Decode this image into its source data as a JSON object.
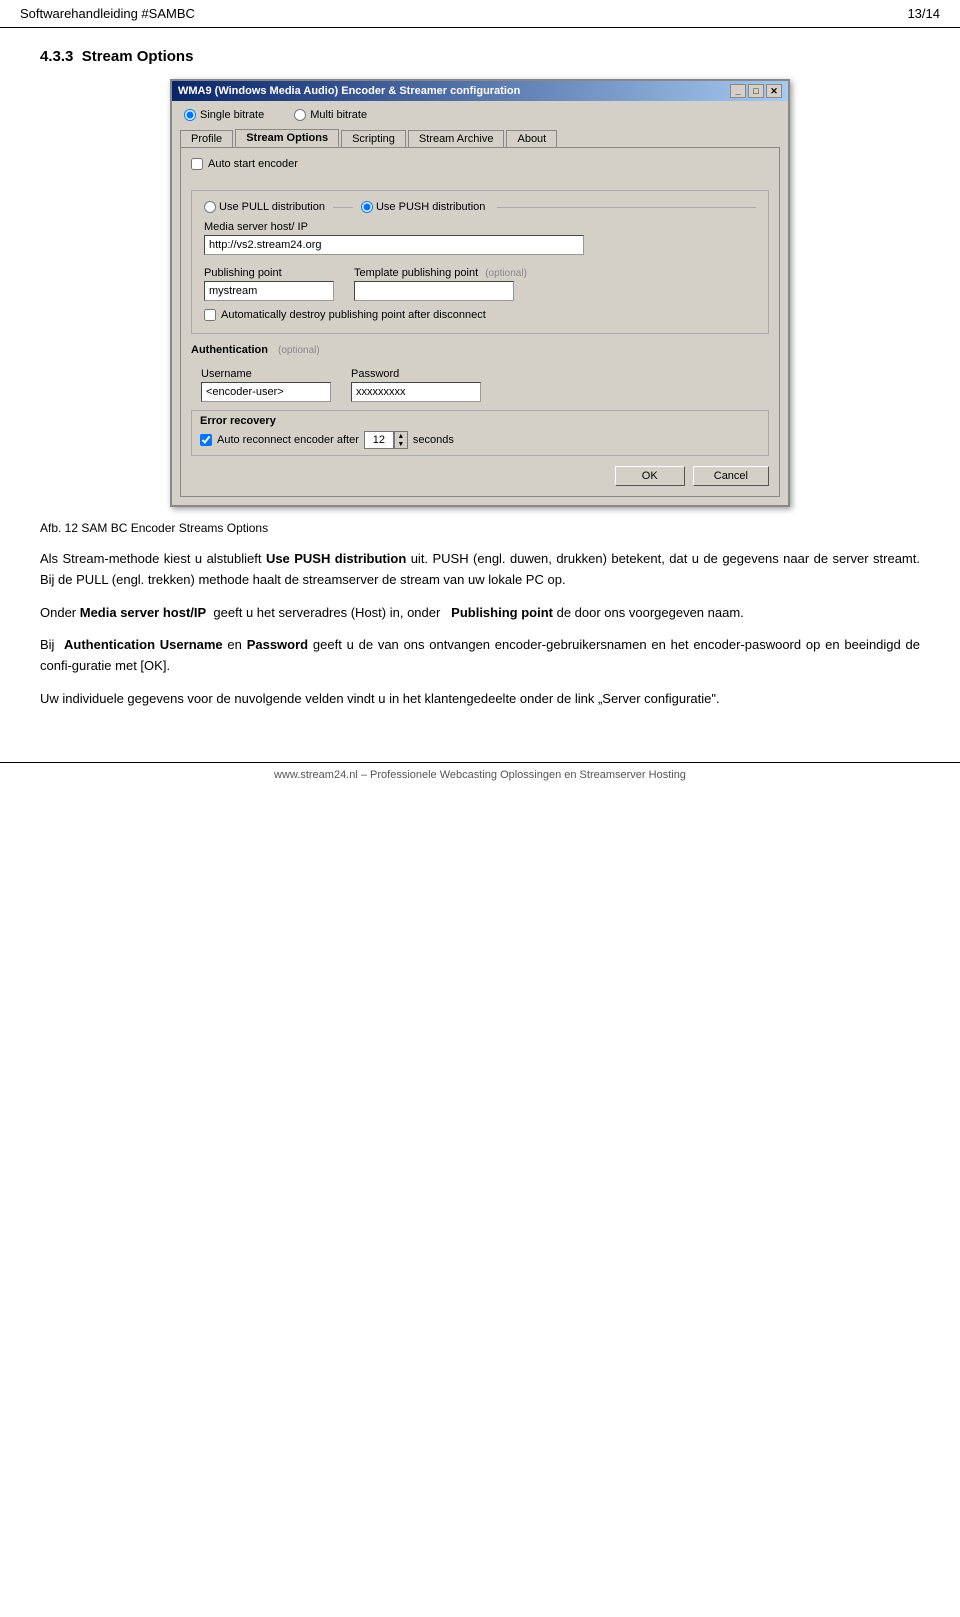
{
  "header": {
    "title": "Softwarehandleiding #SAMBC",
    "page": "13/14"
  },
  "section": {
    "number": "4.3.3",
    "title": "Stream Options"
  },
  "dialog": {
    "title": "WMA9 (Windows Media Audio) Encoder & Streamer configuration",
    "titlebar_buttons": [
      "_",
      "□",
      "✕"
    ],
    "radio_options": [
      {
        "label": "Single bitrate",
        "checked": true
      },
      {
        "label": "Multi bitrate",
        "checked": false
      }
    ],
    "tabs": [
      {
        "label": "Profile",
        "active": false
      },
      {
        "label": "Stream Options",
        "active": true
      },
      {
        "label": "Scripting",
        "active": false
      },
      {
        "label": "Stream Archive",
        "active": false
      },
      {
        "label": "About",
        "active": false
      }
    ],
    "tab_content": {
      "auto_start": {
        "checkbox_label": "Auto start encoder",
        "checked": false
      },
      "distribution": {
        "pull_label": "Use PULL distribution",
        "pull_checked": false,
        "push_label": "Use PUSH distribution",
        "push_checked": true,
        "media_server_label": "Media server host/ IP",
        "media_server_value": "http://vs2.stream24.org",
        "publishing_point_label": "Publishing point",
        "publishing_point_value": "mystream",
        "template_label": "Template publishing point",
        "template_optional": "(optional)",
        "template_value": "",
        "auto_destroy_label": "Automatically destroy publishing point after disconnect",
        "auto_destroy_checked": false
      },
      "authentication": {
        "title": "Authentication",
        "optional": "(optional)",
        "username_label": "Username",
        "username_value": "<encoder-user>",
        "password_label": "Password",
        "password_value": "xxxxxxxxx"
      },
      "error_recovery": {
        "title": "Error recovery",
        "checkbox_label": "Auto reconnect encoder after",
        "checkbox_checked": true,
        "seconds_value": "12",
        "seconds_label": "seconds"
      },
      "buttons": {
        "ok": "OK",
        "cancel": "Cancel"
      }
    }
  },
  "caption": "Afb. 12 SAM BC Encoder Streams Options",
  "paragraphs": [
    {
      "id": "p1",
      "text": "Als Stream-methode kiest u alstublieft Use PUSH distribution uit. PUSH (engl. duwen, drukken) betekent, dat u de gegevens naar de server streamt. Bij de PULL (engl. trekken) methode haalt de streamserver de stream van uw lokale PC op."
    },
    {
      "id": "p2",
      "text_before": "Onder ",
      "bold": "Media server host/IP",
      "text_middle": "  geeft u het serveradres (Host) in, onder  ",
      "bold2": "Publishing",
      "text_after_bold2": "",
      "newline": "point de door ons voorgegeven naam."
    },
    {
      "id": "p3",
      "text_before": "Bij  ",
      "bold": "Authentication Username",
      "text_middle": " en ",
      "bold2": "Password",
      "text_after": " geeft u de van ons ontvangen encoder-gebruikersnamen en het encoder-paswoord op en beeindigd de confi-guratie met [OK]."
    },
    {
      "id": "p4",
      "text": "Uw individuele gegevens voor de nuvolgende velden vindt u in het klantengedeelte onder de link „Server configuratie\"."
    }
  ],
  "footer": {
    "text": "www.stream24.nl – Professionele Webcasting Oplossingen en Streamserver Hosting"
  }
}
